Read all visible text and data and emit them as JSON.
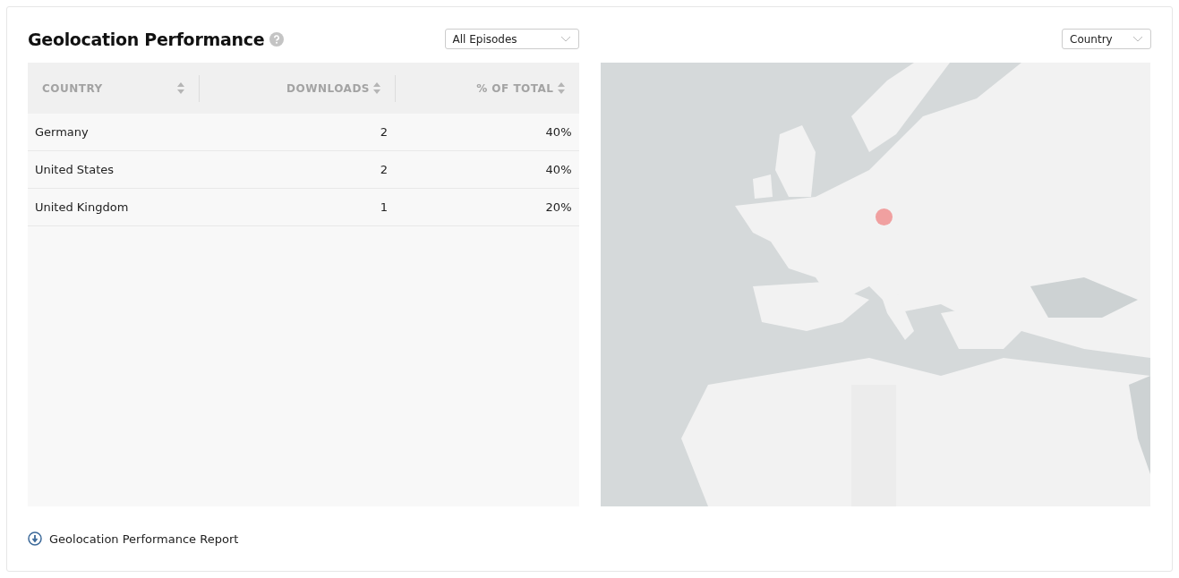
{
  "title": "Geolocation Performance",
  "episode_filter": {
    "value": "All Episodes"
  },
  "map_filter": {
    "value": "Country"
  },
  "table": {
    "columns": [
      {
        "label": "COUNTRY"
      },
      {
        "label": "DOWNLOADS"
      },
      {
        "label": "% OF TOTAL"
      }
    ],
    "rows": [
      [
        "Germany",
        "2",
        "40%"
      ],
      [
        "United States",
        "2",
        "40%"
      ],
      [
        "United Kingdom",
        "1",
        "20%"
      ]
    ]
  },
  "report_link": "Geolocation Performance Report"
}
